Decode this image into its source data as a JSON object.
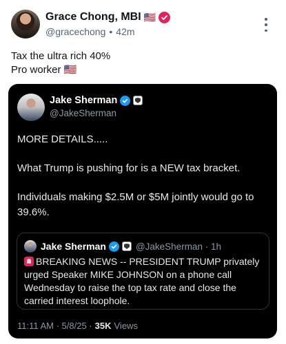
{
  "post": {
    "author": {
      "name": "Grace Chong, MBI",
      "name_flag": "🇺🇸",
      "handle": "@gracechong",
      "separator": "•",
      "time": "42m"
    },
    "text_lines": [
      "Tax the ultra rich 40%",
      "Pro worker 🇺🇸"
    ],
    "colors": {
      "badge": "#e0245e",
      "text": "#0f1419",
      "muted": "#536471"
    }
  },
  "quoted": {
    "author": {
      "name": "Jake Sherman",
      "handle": "@JakeSherman"
    },
    "paragraphs": [
      "MORE DETAILS.....",
      "What Trump is pushing for is a NEW tax bracket.",
      "Individuals making $2.5M or $5M jointly would go to 39.6%."
    ],
    "inner_quote": {
      "name": "Jake Sherman",
      "handle_time": "@JakeSherman · 1h",
      "text": "BREAKING NEWS -- PRESIDENT TRUMP privately urged Speaker MIKE JOHNSON on a phone call Wednesday to raise the top tax rate and close the carried interest loophole."
    },
    "footer": {
      "timestamp": "11:11 AM · 5/8/25 · ",
      "views_count": "35K",
      "views_label": "Views"
    },
    "colors": {
      "background": "#000000",
      "verified": "#1d9bf0",
      "muted": "#8b98a5"
    }
  }
}
